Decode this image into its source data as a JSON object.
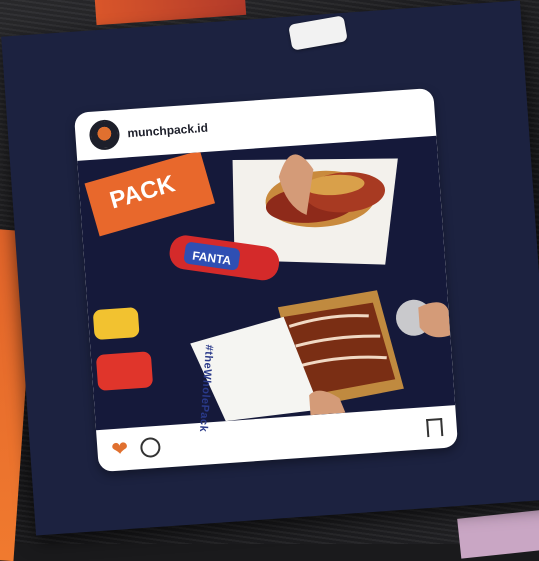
{
  "post": {
    "username": "munchpack.id"
  },
  "photo": {
    "box_text": "#theWholePack",
    "pack_text": "PACK"
  },
  "colors": {
    "accent": "#e0702f",
    "poster_bg": "#1c2240"
  },
  "icons": {
    "like": "heart-icon",
    "comment": "comment-icon",
    "save": "bookmark-icon"
  }
}
